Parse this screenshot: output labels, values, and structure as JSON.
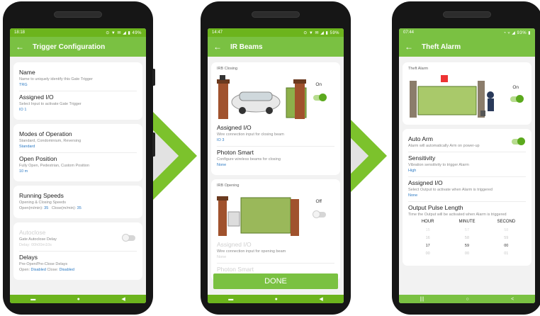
{
  "phone1": {
    "status": {
      "time": "18:18",
      "icons": "⊙ ▼ ✉ ◢ ▮ 49%"
    },
    "toolbar": {
      "title": "Trigger Configuration"
    },
    "name": {
      "title": "Name",
      "subtitle": "Name to uniquely identify this Gate Trigger",
      "value": "TRG"
    },
    "assigned_io": {
      "title": "Assigned I/O",
      "subtitle": "Select Input to activate Gate Trigger",
      "value": "IO 1"
    },
    "modes": {
      "title": "Modes of Operation",
      "subtitle": "Standard, Condominium, Reversing",
      "value": "Standard"
    },
    "open_position": {
      "title": "Open Position",
      "subtitle": "Fully Open, Pedestrian, Custom Position",
      "value": "10 m"
    },
    "running_speeds": {
      "title": "Running Speeds",
      "subtitle": "Opening & Closing Speeds",
      "open_label": "Open(m/min):",
      "open_value": "35",
      "close_label": "Close(m/min):",
      "close_value": "35"
    },
    "autoclose": {
      "title": "Autoclose",
      "subtitle": "Gate Autoclose Delay",
      "value": "Delay: 00h00m10s"
    },
    "delays": {
      "title": "Delays",
      "subtitle": "Pre-Open/Pre-Close Delays",
      "open_label": "Open:",
      "open_value": "Disabled",
      "close_label": "Close:",
      "close_value": "Disabled"
    }
  },
  "phone2": {
    "status": {
      "time": "14:47",
      "icons": "⊙ ▼ ✉ ◢ ▮ 59%"
    },
    "toolbar": {
      "title": "IR Beams"
    },
    "irb_closing": {
      "label": "IRB Closing",
      "toggle_label": "On"
    },
    "closing_assigned_io": {
      "title": "Assigned I/O",
      "subtitle": "Wire connection input for closing beam",
      "value": "IO 3"
    },
    "photon_smart": {
      "title": "Photon Smart",
      "subtitle": "Configure wireless beams for closing",
      "value": "None"
    },
    "irb_opening": {
      "label": "IRB Opening",
      "toggle_label": "Off"
    },
    "opening_assigned_io": {
      "title": "Assigned I/O",
      "subtitle": "Wire connection input for opening beam",
      "value": "None"
    },
    "photon_smart_open": {
      "title": "Photon Smart"
    },
    "done_label": "DONE"
  },
  "phone3": {
    "status": {
      "time": "07:44",
      "icons": "◔ ▿ ◢ 93% ▮"
    },
    "toolbar": {
      "title": "Theft Alarm"
    },
    "theft_alarm": {
      "label": "Theft Alarm",
      "toggle_label": "On"
    },
    "auto_arm": {
      "title": "Auto Arm",
      "subtitle": "Alarm will automatically Arm on power-up"
    },
    "sensitivity": {
      "title": "Sensitivity",
      "subtitle": "Vibration sensitivity to trigger Alarm",
      "value": "High"
    },
    "assigned_io": {
      "title": "Assigned I/O",
      "subtitle": "Select Output to activate when Alarm is triggered",
      "value": "None"
    },
    "pulse": {
      "title": "Output Pulse Length",
      "subtitle": "Time the Output will be activated when Alarm is triggered"
    },
    "time_headers": [
      "HOUR",
      "MINUTE",
      "SECOND"
    ],
    "time_rows": [
      [
        "15",
        "57",
        "58"
      ],
      [
        "16",
        "58",
        "59"
      ],
      [
        "17",
        "59",
        "00"
      ],
      [
        "00",
        "00",
        "01"
      ]
    ]
  },
  "nav": {
    "recent": "▬",
    "home": "●",
    "back": "◀",
    "recent3": "|||",
    "home3": "○",
    "back3": "<"
  },
  "colors": {
    "brand_green": "#7ac142",
    "status_green": "#6cb41d",
    "link_blue": "#2e7bc4",
    "arrow_green": "#7cc22c"
  }
}
